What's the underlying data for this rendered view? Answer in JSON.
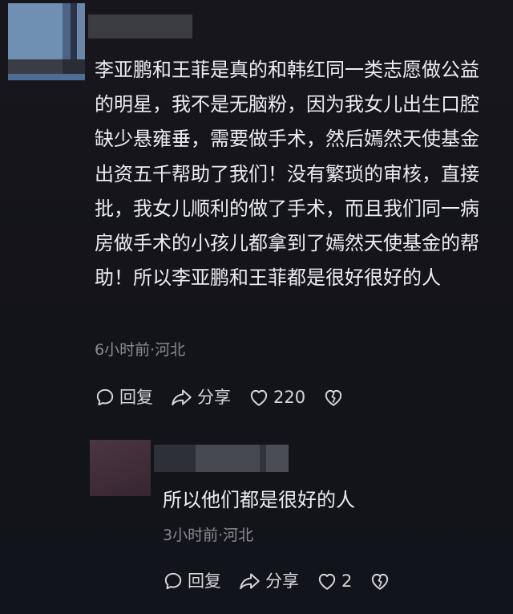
{
  "comment": {
    "avatar_icon": "user-avatar-blurred",
    "text": "李亚鹏和王菲是真的和韩红同一类志愿做公益的明星，我不是无脑粉，因为我女儿出生口腔缺少悬雍垂，需要做手术，然后嫣然天使基金出资五千帮助了我们！没有繁琐的审核，直接批，我女儿顺利的做了手术，而且我们同一病房做手术的小孩儿都拿到了嫣然天使基金的帮助！所以李亚鹏和王菲都是很好很好的人",
    "meta": "6小时前·河北",
    "actions": {
      "reply_label": "回复",
      "share_label": "分享",
      "like_count": "220"
    }
  },
  "reply": {
    "avatar_icon": "user-avatar-blurred",
    "text": "所以他们都是很好的人",
    "meta": "3小时前·河北",
    "actions": {
      "reply_label": "回复",
      "share_label": "分享",
      "like_count": "2"
    }
  },
  "colors": {
    "background": "#15151b",
    "text_primary": "#ededf0",
    "text_secondary": "#8b8c93"
  }
}
